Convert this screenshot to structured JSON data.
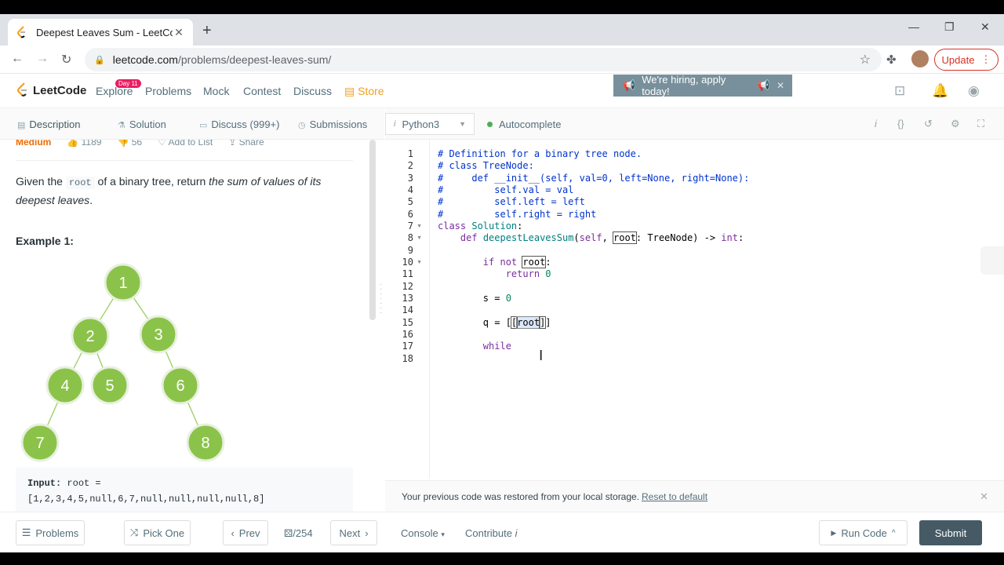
{
  "browser": {
    "tab_title": "Deepest Leaves Sum - LeetCode",
    "url_host": "leetcode.com",
    "url_path": "/problems/deepest-leaves-sum/",
    "update_label": "Update"
  },
  "nav": {
    "logo": "LeetCode",
    "day_badge": "Day 11",
    "links": [
      "Explore",
      "Problems",
      "Mock",
      "Contest",
      "Discuss"
    ],
    "store": "Store",
    "hiring": "We're hiring, apply today!"
  },
  "left_tabs": [
    "Description",
    "Solution",
    "Discuss (999+)",
    "Submissions"
  ],
  "problem": {
    "difficulty": "Medium",
    "likes": "1189",
    "dislikes": "56",
    "add_to_list": "Add to List",
    "share": "Share",
    "text_before": "Given the ",
    "code_word": "root",
    "text_middle": " of a binary tree, return ",
    "text_em": "the sum of values of its deepest leaves",
    "text_after": ".",
    "example_title": "Example 1:",
    "tree_nodes": [
      "1",
      "2",
      "3",
      "4",
      "5",
      "6",
      "7",
      "8"
    ],
    "input_label": "Input:",
    "input_value": "root = [1,2,3,4,5,null,6,7,null,null,null,null,8]"
  },
  "editor": {
    "language": "Python3",
    "autocomplete": "Autocomplete",
    "line_numbers": [
      "1",
      "2",
      "3",
      "4",
      "5",
      "6",
      "7",
      "8",
      "9",
      "10",
      "11",
      "12",
      "13",
      "14",
      "15",
      "16",
      "17",
      "18"
    ],
    "restore_text": "Your previous code was restored from your local storage.",
    "reset_link": "Reset to default"
  },
  "footer": {
    "problems": "Problems",
    "pick_one": "Pick One",
    "prev": "Prev",
    "counter": "/254",
    "next": "Next",
    "console": "Console",
    "contribute": "Contribute",
    "run_code": "Run Code",
    "submit": "Submit"
  },
  "colors": {
    "accent_green": "#8bc34a",
    "submit_bg": "#455a64",
    "difficulty": "#ef6c00"
  }
}
